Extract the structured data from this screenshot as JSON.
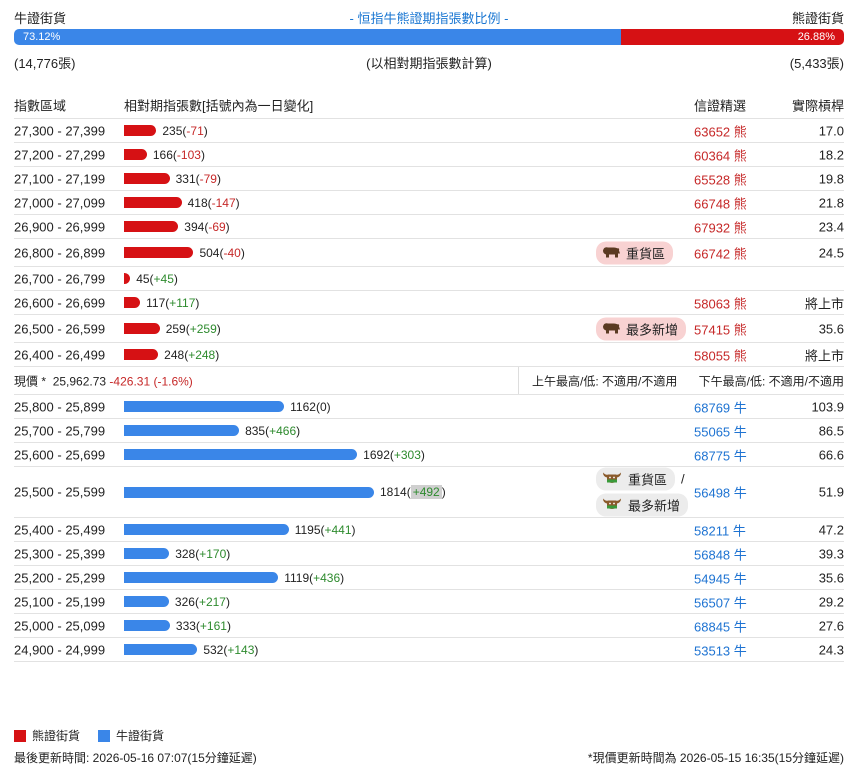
{
  "header": {
    "left": "牛證街貨",
    "center": "- 恒指牛熊證期指張數比例 -",
    "right": "熊證街貨"
  },
  "ratio": {
    "bull": "73.12%",
    "bear": "26.88%",
    "bull_fraction": 0.7312
  },
  "counts": {
    "bull": "(14,776張)",
    "center": "(以相對期指張數計算)",
    "bear": "(5,433張)"
  },
  "colors": {
    "bear": "#d61114",
    "bull": "#3a86e8"
  },
  "table_head": {
    "range": "指數區域",
    "contracts": "相對期指張數[括號內為一日變化]",
    "code": "信證精選",
    "leverage": "實際槓桿"
  },
  "bear_rows": [
    {
      "range": "27,300 - 27,399",
      "count": "235",
      "change": "-71",
      "code": "63652",
      "type": "熊",
      "lev": "17.0",
      "n": 235
    },
    {
      "range": "27,200 - 27,299",
      "count": "166",
      "change": "-103",
      "code": "60364",
      "type": "熊",
      "lev": "18.2",
      "n": 166
    },
    {
      "range": "27,100 - 27,199",
      "count": "331",
      "change": "-79",
      "code": "65528",
      "type": "熊",
      "lev": "19.8",
      "n": 331
    },
    {
      "range": "27,000 - 27,099",
      "count": "418",
      "change": "-147",
      "code": "66748",
      "type": "熊",
      "lev": "21.8",
      "n": 418
    },
    {
      "range": "26,900 - 26,999",
      "count": "394",
      "change": "-69",
      "code": "67932",
      "type": "熊",
      "lev": "23.4",
      "n": 394
    },
    {
      "range": "26,800 - 26,899",
      "count": "504",
      "change": "-40",
      "code": "66742",
      "type": "熊",
      "lev": "24.5",
      "n": 504,
      "tag": "重貨區",
      "tall": true
    },
    {
      "range": "26,700 - 26,799",
      "count": "45",
      "change": "+45",
      "code": "",
      "type": "",
      "lev": "",
      "n": 45
    },
    {
      "range": "26,600 - 26,699",
      "count": "117",
      "change": "+117",
      "code": "58063",
      "type": "熊",
      "lev": "將上市",
      "n": 117
    },
    {
      "range": "26,500 - 26,599",
      "count": "259",
      "change": "+259",
      "code": "57415",
      "type": "熊",
      "lev": "35.6",
      "n": 259,
      "tag": "最多新增",
      "tall": true
    },
    {
      "range": "26,400 - 26,499",
      "count": "248",
      "change": "+248",
      "code": "58055",
      "type": "熊",
      "lev": "將上市",
      "n": 248
    }
  ],
  "price_row": {
    "label": "現價 *",
    "value": "25,962.73",
    "change": "-426.31 (-1.6%)",
    "am": "上午最高/低: 不適用/不適用",
    "pm": "下午最高/低: 不適用/不適用"
  },
  "bull_rows": [
    {
      "range": "25,800 - 25,899",
      "count": "1162",
      "change": "0",
      "code": "68769",
      "type": "牛",
      "lev": "103.9",
      "n": 1162
    },
    {
      "range": "25,700 - 25,799",
      "count": "835",
      "change": "+466",
      "code": "55065",
      "type": "牛",
      "lev": "86.5",
      "n": 835
    },
    {
      "range": "25,600 - 25,699",
      "count": "1692",
      "change": "+303",
      "code": "68775",
      "type": "牛",
      "lev": "66.6",
      "n": 1692
    },
    {
      "range": "25,500 - 25,599",
      "count": "1814",
      "change": "+492",
      "code": "56498",
      "type": "牛",
      "lev": "51.9",
      "n": 1814,
      "tag": "重貨區",
      "tag_sep": "/",
      "tag2": "最多新增",
      "big": true,
      "hl": true
    },
    {
      "range": "25,400 - 25,499",
      "count": "1195",
      "change": "+441",
      "code": "58211",
      "type": "牛",
      "lev": "47.2",
      "n": 1195
    },
    {
      "range": "25,300 - 25,399",
      "count": "328",
      "change": "+170",
      "code": "56848",
      "type": "牛",
      "lev": "39.3",
      "n": 328
    },
    {
      "range": "25,200 - 25,299",
      "count": "1119",
      "change": "+436",
      "code": "54945",
      "type": "牛",
      "lev": "35.6",
      "n": 1119
    },
    {
      "range": "25,100 - 25,199",
      "count": "326",
      "change": "+217",
      "code": "56507",
      "type": "牛",
      "lev": "29.2",
      "n": 326
    },
    {
      "range": "25,000 - 25,099",
      "count": "333",
      "change": "+161",
      "code": "68845",
      "type": "牛",
      "lev": "27.6",
      "n": 333
    },
    {
      "range": "24,900 - 24,999",
      "count": "532",
      "change": "+143",
      "code": "53513",
      "type": "牛",
      "lev": "24.3",
      "n": 532
    }
  ],
  "legend": {
    "bear": "熊證街貨",
    "bull": "牛證街貨"
  },
  "footer": {
    "left": "最後更新時間: 2026-05-16 07:07(15分鐘延遲)",
    "right": "*現價更新時間為 2026-05-15 16:35(15分鐘延遲)"
  }
}
